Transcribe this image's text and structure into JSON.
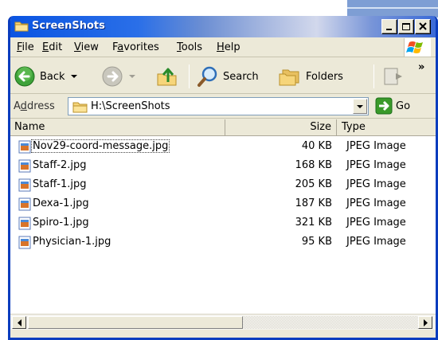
{
  "window": {
    "title": "ScreenShots"
  },
  "menu": {
    "items": [
      {
        "key": "F",
        "rest": "ile"
      },
      {
        "key": "E",
        "rest": "dit"
      },
      {
        "key": "V",
        "rest": "iew"
      },
      {
        "pre": "F",
        "key": "a",
        "rest": "vorites"
      },
      {
        "key": "T",
        "rest": "ools"
      },
      {
        "key": "H",
        "rest": "elp"
      }
    ]
  },
  "toolbar": {
    "back_label": "Back",
    "search_label": "Search",
    "folders_label": "Folders",
    "overflow": "»"
  },
  "address": {
    "label_pre": "A",
    "label_key": "d",
    "label_rest": "dress",
    "value": "H:\\ScreenShots",
    "go_label": "Go"
  },
  "columns": {
    "name": "Name",
    "size": "Size",
    "type": "Type"
  },
  "files": [
    {
      "name": "Nov29-coord-message.jpg",
      "size": "40 KB",
      "type": "JPEG Image"
    },
    {
      "name": "Staff-2.jpg",
      "size": "168 KB",
      "type": "JPEG Image"
    },
    {
      "name": "Staff-1.jpg",
      "size": "205 KB",
      "type": "JPEG Image"
    },
    {
      "name": "Dexa-1.jpg",
      "size": "187 KB",
      "type": "JPEG Image"
    },
    {
      "name": "Spiro-1.jpg",
      "size": "321 KB",
      "type": "JPEG Image"
    },
    {
      "name": "Physician-1.jpg",
      "size": "95 KB",
      "type": "JPEG Image"
    }
  ],
  "colors": {
    "titlebar": "#0a54e2",
    "window_border": "#0a3dbe",
    "chrome": "#ece9d8",
    "go_green": "#3a9a2a"
  }
}
